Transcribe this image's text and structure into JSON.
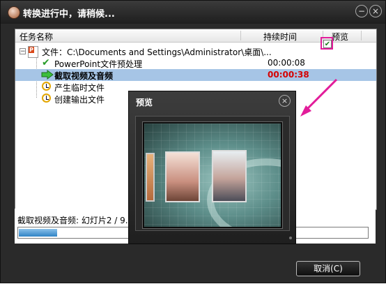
{
  "window": {
    "title": "转换进行中，请稍候..."
  },
  "columns": {
    "task": "任务名称",
    "duration": "持续时间",
    "preview": "预览"
  },
  "tasks": [
    {
      "label": "文件：C:\\Documents and Settings\\Administrator\\桌面\\...",
      "duration": "",
      "icon": "powerpoint-file-icon",
      "toggle": "−"
    },
    {
      "label": "PowerPoint文件预处理",
      "duration": "00:00:08",
      "icon": "check-icon"
    },
    {
      "label": "截取视频及音频",
      "duration": "00:00:38",
      "icon": "arrow-right-icon",
      "selected": true,
      "preview_checked": true
    },
    {
      "label": "产生临时文件",
      "duration": "",
      "icon": "clock-icon"
    },
    {
      "label": "创建输出文件",
      "duration": "",
      "icon": "clock-icon"
    }
  ],
  "status": {
    "text": "截取视频及音频: 幻灯片2 / 9...",
    "progress_fraction": 0.11
  },
  "buttons": {
    "cancel": "取消(C)",
    "minimize": "−",
    "close": "×"
  },
  "preview_dialog": {
    "title": "预览",
    "close": "×"
  },
  "colors": {
    "accent": "#e21c9a",
    "selected_row": "#a6c5e6",
    "running_time": "#d50000"
  }
}
